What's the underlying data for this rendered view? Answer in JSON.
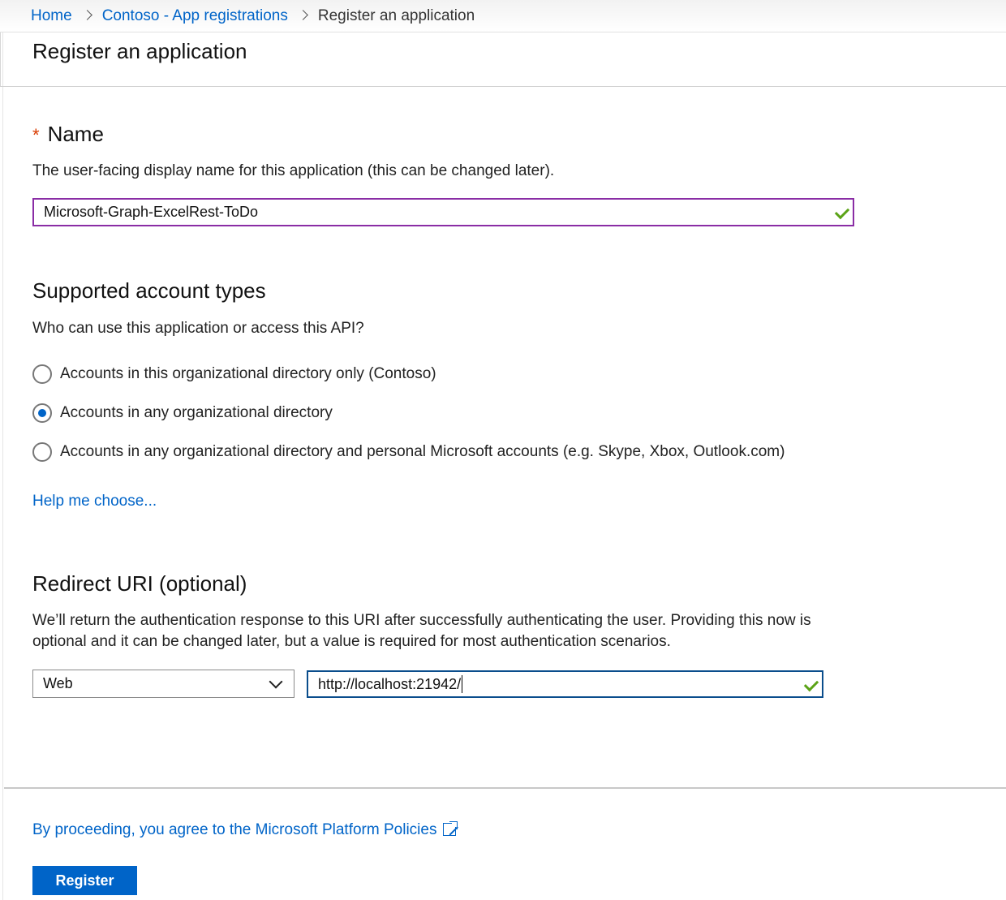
{
  "breadcrumb": {
    "home": "Home",
    "parent": "Contoso - App registrations",
    "current": "Register an application"
  },
  "header": {
    "title": "Register an application"
  },
  "name_section": {
    "required_marker": "*",
    "title": "Name",
    "description": "The user-facing display name for this application (this can be changed later).",
    "value": "Microsoft-Graph-ExcelRest-ToDo"
  },
  "account_types": {
    "title": "Supported account types",
    "description": "Who can use this application or access this API?",
    "options": [
      {
        "label": "Accounts in this organizational directory only (Contoso)",
        "selected": false
      },
      {
        "label": "Accounts in any organizational directory",
        "selected": true
      },
      {
        "label": "Accounts in any organizational directory and personal Microsoft accounts (e.g. Skype, Xbox, Outlook.com)",
        "selected": false
      }
    ],
    "help_link": "Help me choose..."
  },
  "redirect_uri": {
    "title": "Redirect URI (optional)",
    "description_line1": "We’ll return the authentication response to this URI after successfully authenticating the user. Providing this now is",
    "description_line2": "optional and it can be changed later, but a value is required for most authentication scenarios.",
    "platform_selected": "Web",
    "uri_value": "http://localhost:21942/"
  },
  "footer": {
    "policy_text": "By proceeding, you agree to the Microsoft Platform Policies",
    "register_label": "Register"
  },
  "colors": {
    "link": "#0064c8",
    "name_input_border": "#8a2da5",
    "uri_input_border": "#0a4d8c",
    "valid_check": "#5ba317",
    "required": "#d83b01",
    "primary_button": "#0064c8"
  }
}
